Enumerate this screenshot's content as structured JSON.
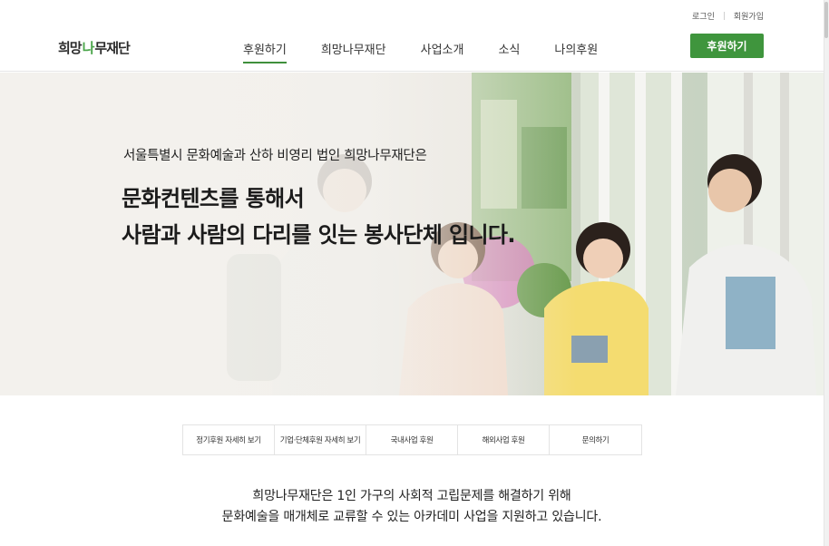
{
  "util": {
    "login": "로그인",
    "signup": "회원가입"
  },
  "logo": {
    "part1": "희망",
    "part2": "나",
    "part3": "무재단"
  },
  "nav": {
    "items": [
      {
        "label": "후원하기"
      },
      {
        "label": "희망나무재단"
      },
      {
        "label": "사업소개"
      },
      {
        "label": "소식"
      },
      {
        "label": "나의후원"
      }
    ],
    "cta": "후원하기"
  },
  "hero": {
    "subtitle": "서울특별시 문화예술과 산하 비영리 법인 희망나무재단은",
    "title_line1": "문화컨텐츠를 통해서",
    "title_line2": "사람과 사람의 다리를 잇는 봉사단체 입니다."
  },
  "quick_links": [
    {
      "label": "정기후원 자세히 보기"
    },
    {
      "label": "기업·단체후원 자세히 보기"
    },
    {
      "label": "국내사업 후원"
    },
    {
      "label": "해외사업 후원"
    },
    {
      "label": "문의하기"
    }
  ],
  "intro": {
    "line1": "희망나무재단은 1인 가구의 사회적 고립문제를 해결하기 위해",
    "line2": "문화예술을 매개체로 교류할 수 있는 아카데미 사업을 지원하고 있습니다."
  },
  "colors": {
    "accent": "#3f953d",
    "underline": "#3f8f3c"
  }
}
